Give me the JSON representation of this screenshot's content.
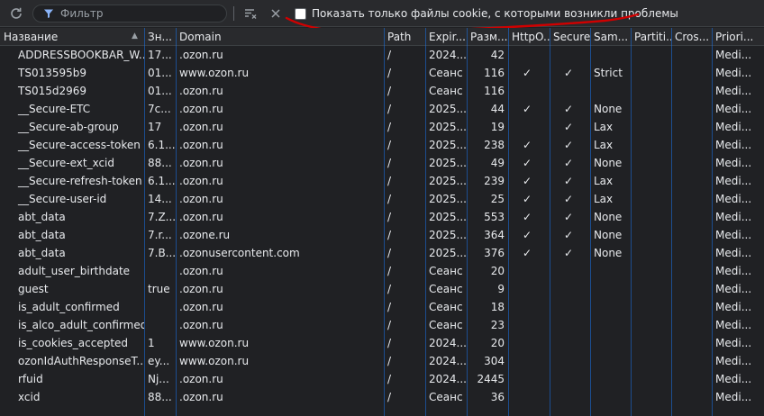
{
  "toolbar": {
    "filter_placeholder": "Фильтр",
    "checkbox_label": "Показать только файлы cookie, с которыми возникли проблемы"
  },
  "columns": [
    "Название",
    "Зн...",
    "Domain",
    "Path",
    "Expir...",
    "Разм...",
    "HttpO...",
    "Secure",
    "Sam...",
    "Partiti...",
    "Cros...",
    "Priori..."
  ],
  "rows": [
    {
      "name": "ADDRESSBOOKBAR_W...",
      "value": "17...",
      "domain": ".ozon.ru",
      "path": "/",
      "expires": "2024...",
      "size": "42",
      "http": "",
      "secure": "",
      "samesite": "",
      "partition": "",
      "cross": "",
      "priority": "Medi..."
    },
    {
      "name": "TS013595b9",
      "value": "01...",
      "domain": "www.ozon.ru",
      "path": "/",
      "expires": "Сеанс",
      "size": "116",
      "http": "✓",
      "secure": "✓",
      "samesite": "Strict",
      "partition": "",
      "cross": "",
      "priority": "Medi..."
    },
    {
      "name": "TS015d2969",
      "value": "01...",
      "domain": ".ozon.ru",
      "path": "/",
      "expires": "Сеанс",
      "size": "116",
      "http": "",
      "secure": "",
      "samesite": "",
      "partition": "",
      "cross": "",
      "priority": "Medi..."
    },
    {
      "name": "__Secure-ETC",
      "value": "7c...",
      "domain": ".ozon.ru",
      "path": "/",
      "expires": "2025...",
      "size": "44",
      "http": "✓",
      "secure": "✓",
      "samesite": "None",
      "partition": "",
      "cross": "",
      "priority": "Medi..."
    },
    {
      "name": "__Secure-ab-group",
      "value": "17",
      "domain": ".ozon.ru",
      "path": "/",
      "expires": "2025...",
      "size": "19",
      "http": "",
      "secure": "✓",
      "samesite": "Lax",
      "partition": "",
      "cross": "",
      "priority": "Medi..."
    },
    {
      "name": "__Secure-access-token",
      "value": "6.1...",
      "domain": ".ozon.ru",
      "path": "/",
      "expires": "2025...",
      "size": "238",
      "http": "✓",
      "secure": "✓",
      "samesite": "Lax",
      "partition": "",
      "cross": "",
      "priority": "Medi..."
    },
    {
      "name": "__Secure-ext_xcid",
      "value": "88...",
      "domain": ".ozon.ru",
      "path": "/",
      "expires": "2025...",
      "size": "49",
      "http": "✓",
      "secure": "✓",
      "samesite": "None",
      "partition": "",
      "cross": "",
      "priority": "Medi..."
    },
    {
      "name": "__Secure-refresh-token",
      "value": "6.1...",
      "domain": ".ozon.ru",
      "path": "/",
      "expires": "2025...",
      "size": "239",
      "http": "✓",
      "secure": "✓",
      "samesite": "Lax",
      "partition": "",
      "cross": "",
      "priority": "Medi..."
    },
    {
      "name": "__Secure-user-id",
      "value": "14...",
      "domain": ".ozon.ru",
      "path": "/",
      "expires": "2025...",
      "size": "25",
      "http": "✓",
      "secure": "✓",
      "samesite": "Lax",
      "partition": "",
      "cross": "",
      "priority": "Medi..."
    },
    {
      "name": "abt_data",
      "value": "7.Z...",
      "domain": ".ozon.ru",
      "path": "/",
      "expires": "2025...",
      "size": "553",
      "http": "✓",
      "secure": "✓",
      "samesite": "None",
      "partition": "",
      "cross": "",
      "priority": "Medi..."
    },
    {
      "name": "abt_data",
      "value": "7.r...",
      "domain": ".ozone.ru",
      "path": "/",
      "expires": "2025...",
      "size": "364",
      "http": "✓",
      "secure": "✓",
      "samesite": "None",
      "partition": "",
      "cross": "",
      "priority": "Medi..."
    },
    {
      "name": "abt_data",
      "value": "7.B...",
      "domain": ".ozonusercontent.com",
      "path": "/",
      "expires": "2025...",
      "size": "376",
      "http": "✓",
      "secure": "✓",
      "samesite": "None",
      "partition": "",
      "cross": "",
      "priority": "Medi..."
    },
    {
      "name": "adult_user_birthdate",
      "value": "",
      "domain": ".ozon.ru",
      "path": "/",
      "expires": "Сеанс",
      "size": "20",
      "http": "",
      "secure": "",
      "samesite": "",
      "partition": "",
      "cross": "",
      "priority": "Medi..."
    },
    {
      "name": "guest",
      "value": "true",
      "domain": ".ozon.ru",
      "path": "/",
      "expires": "Сеанс",
      "size": "9",
      "http": "",
      "secure": "",
      "samesite": "",
      "partition": "",
      "cross": "",
      "priority": "Medi..."
    },
    {
      "name": "is_adult_confirmed",
      "value": "",
      "domain": ".ozon.ru",
      "path": "/",
      "expires": "Сеанс",
      "size": "18",
      "http": "",
      "secure": "",
      "samesite": "",
      "partition": "",
      "cross": "",
      "priority": "Medi..."
    },
    {
      "name": "is_alco_adult_confirmed",
      "value": "",
      "domain": ".ozon.ru",
      "path": "/",
      "expires": "Сеанс",
      "size": "23",
      "http": "",
      "secure": "",
      "samesite": "",
      "partition": "",
      "cross": "",
      "priority": "Medi..."
    },
    {
      "name": "is_cookies_accepted",
      "value": "1",
      "domain": "www.ozon.ru",
      "path": "/",
      "expires": "2024...",
      "size": "20",
      "http": "",
      "secure": "",
      "samesite": "",
      "partition": "",
      "cross": "",
      "priority": "Medi..."
    },
    {
      "name": "ozonIdAuthResponseT...",
      "value": "ey...",
      "domain": "www.ozon.ru",
      "path": "/",
      "expires": "2024...",
      "size": "304",
      "http": "",
      "secure": "",
      "samesite": "",
      "partition": "",
      "cross": "",
      "priority": "Medi..."
    },
    {
      "name": "rfuid",
      "value": "Nj...",
      "domain": ".ozon.ru",
      "path": "/",
      "expires": "2024...",
      "size": "2445",
      "http": "",
      "secure": "",
      "samesite": "",
      "partition": "",
      "cross": "",
      "priority": "Medi..."
    },
    {
      "name": "xcid",
      "value": "88...",
      "domain": ".ozon.ru",
      "path": "/",
      "expires": "Сеанс",
      "size": "36",
      "http": "",
      "secure": "",
      "samesite": "",
      "partition": "",
      "cross": "",
      "priority": "Medi..."
    }
  ]
}
